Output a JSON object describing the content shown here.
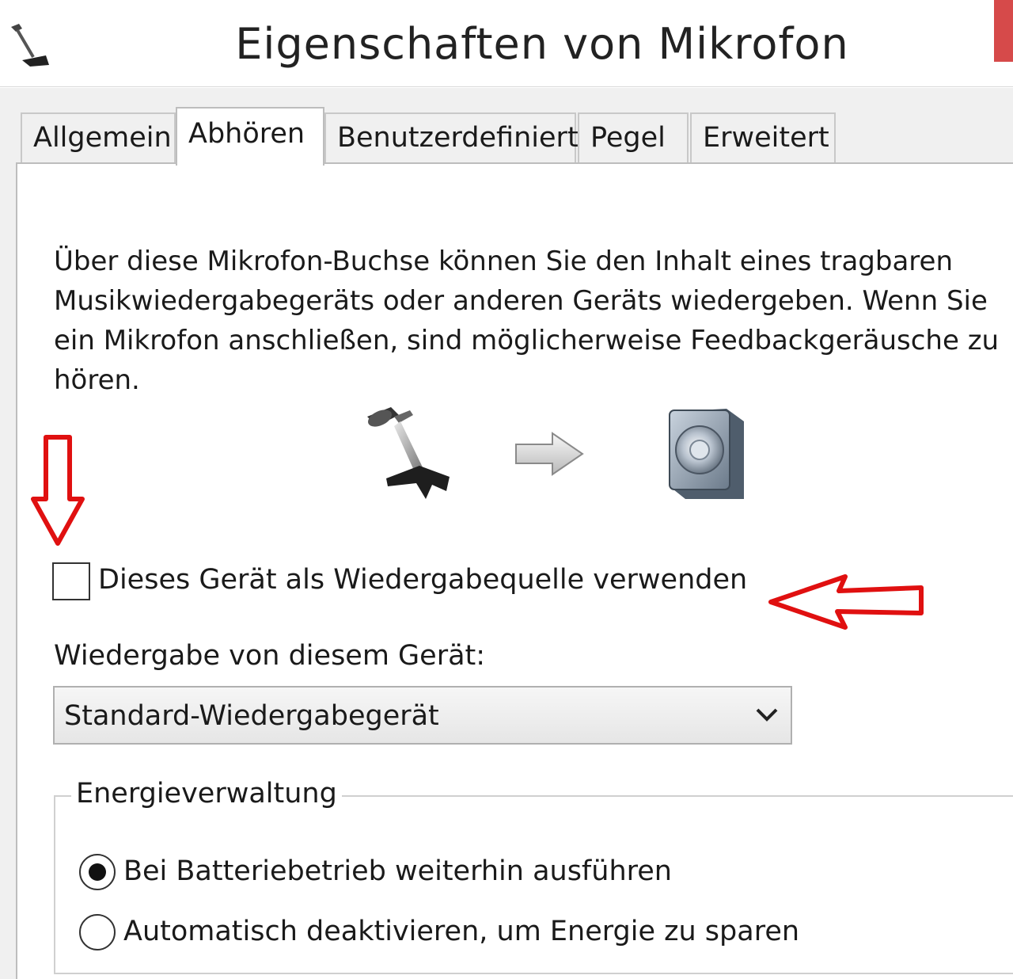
{
  "window": {
    "title": "Eigenschaften von Mikrofon"
  },
  "tabs": [
    {
      "label": "Allgemein",
      "active": false
    },
    {
      "label": "Abhören",
      "active": true
    },
    {
      "label": "Benutzerdefiniert",
      "active": false
    },
    {
      "label": "Pegel",
      "active": false
    },
    {
      "label": "Erweitert",
      "active": false
    }
  ],
  "listen": {
    "description": "Über diese Mikrofon-Buchse können Sie den Inhalt eines tragbaren\nMusikwiedergabegeräts oder anderen Geräts wiedergeben. Wenn Sie\nein Mikrofon anschließen, sind möglicherweise Feedbackgeräusche zu\nhören.",
    "checkbox_label": "Dieses Gerät als Wiedergabequelle verwenden",
    "checkbox_checked": false,
    "playback_label": "Wiedergabe von diesem Gerät:",
    "playback_device": "Standard-Wiedergabegerät"
  },
  "power": {
    "group_title": "Energieverwaltung",
    "options": [
      {
        "label": "Bei Batteriebetrieb weiterhin ausführen",
        "selected": true
      },
      {
        "label": "Automatisch deaktivieren, um Energie zu sparen",
        "selected": false
      }
    ]
  },
  "icons": {
    "window_icon": "microphone-icon",
    "source_icon": "microphone-icon",
    "flow_icon": "arrow-right-icon",
    "target_icon": "speaker-icon",
    "dropdown_icon": "chevron-down-icon"
  },
  "colors": {
    "annotation_red": "#e01010",
    "close_button": "#d64a4a"
  }
}
